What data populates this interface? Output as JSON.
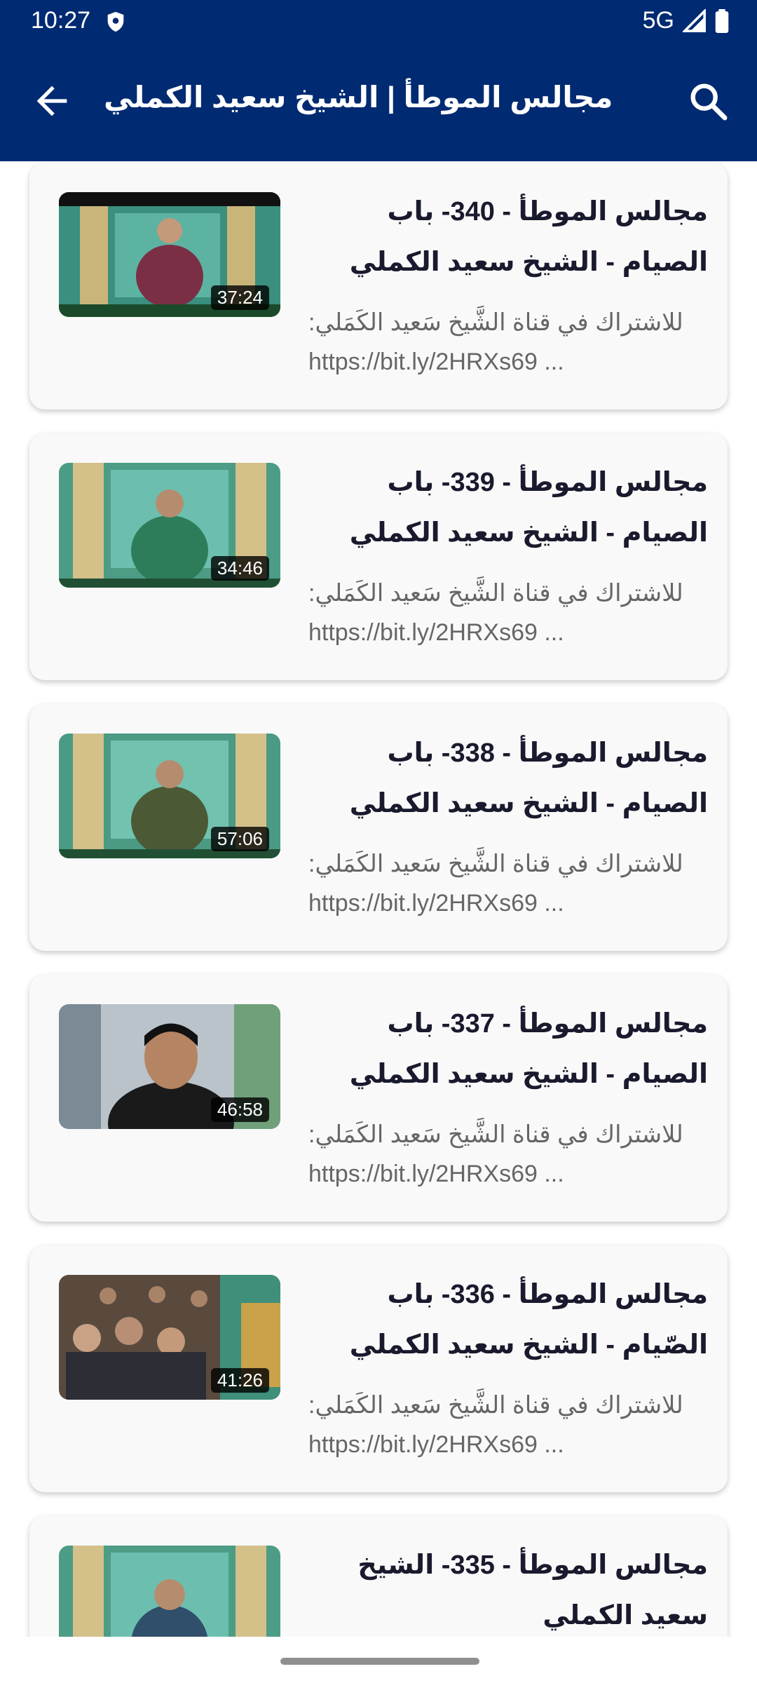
{
  "status_bar": {
    "time": "10:27",
    "network": "5G"
  },
  "app_bar": {
    "title": "مجالس الموطأ | الشيخ سعيد الكملي",
    "back_icon": "arrow-left-icon",
    "search_icon": "search-icon"
  },
  "videos": [
    {
      "title": "مجالس الموطأ - 340- باب الصيام - الشيخ سعيد الكملي",
      "description_line1": "للاشتراك في قناة الشَّيخ سَعيد الكَمَلي:",
      "description_line2": "https://bit.ly/2HRXs69 ...",
      "duration": "37:24"
    },
    {
      "title": "مجالس الموطأ - 339- باب الصيام - الشيخ سعيد الكملي",
      "description_line1": "للاشتراك في قناة الشَّيخ سَعيد الكَمَلي:",
      "description_line2": "https://bit.ly/2HRXs69 ...",
      "duration": "34:46"
    },
    {
      "title": "مجالس الموطأ - 338- باب الصيام - الشيخ سعيد الكملي",
      "description_line1": "للاشتراك في قناة الشَّيخ سَعيد الكَمَلي:",
      "description_line2": "https://bit.ly/2HRXs69 ...",
      "duration": "57:06"
    },
    {
      "title": "مجالس الموطأ - 337- باب الصيام - الشيخ سعيد الكملي",
      "description_line1": "للاشتراك في قناة الشَّيخ سَعيد الكَمَلي:",
      "description_line2": "https://bit.ly/2HRXs69 ...",
      "duration": "46:58"
    },
    {
      "title": "مجالس الموطأ - 336- باب الصّيام - الشيخ سعيد الكملي",
      "description_line1": "للاشتراك في قناة الشَّيخ سَعيد الكَمَلي:",
      "description_line2": "https://bit.ly/2HRXs69 ...",
      "duration": "41:26"
    },
    {
      "title": "مجالس الموطأ - 335- الشيخ سعيد الكملي",
      "description_line1": "",
      "description_line2": "",
      "duration": ""
    }
  ],
  "colors": {
    "app_bar": "#002a72",
    "card": "#f9f9f9",
    "title_text": "#1a1a2e",
    "desc_text": "#666666"
  }
}
